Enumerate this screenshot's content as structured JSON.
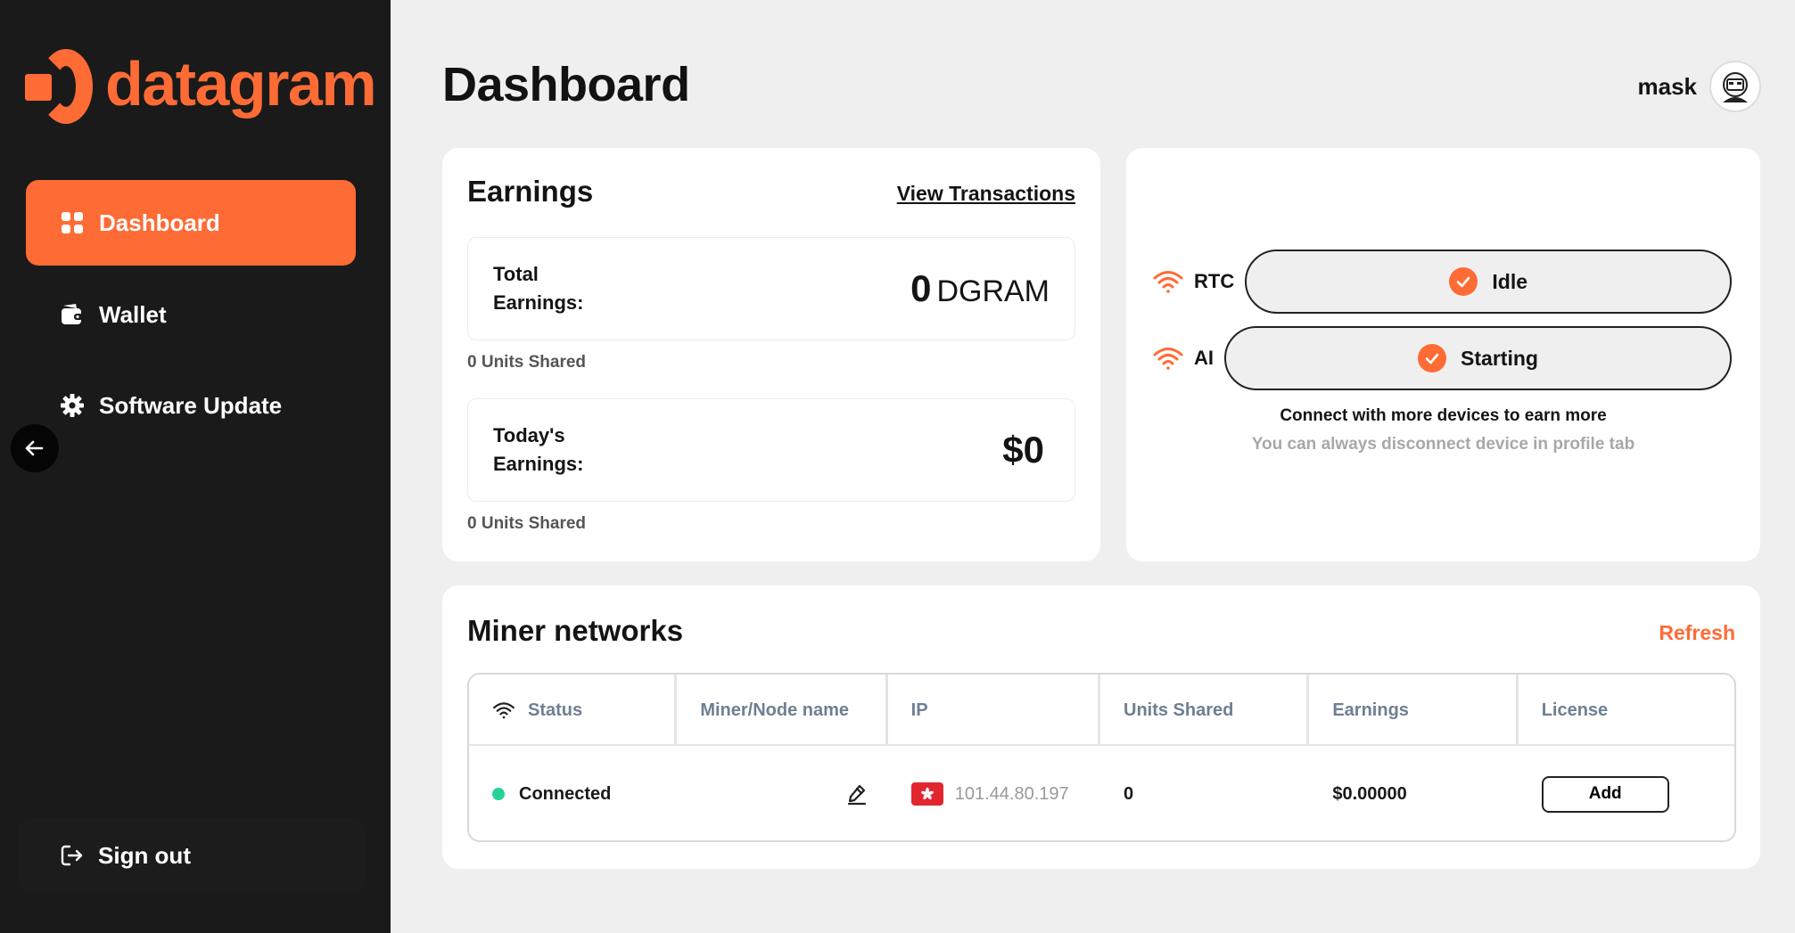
{
  "brand": {
    "name": "datagram",
    "color": "#ff6b35"
  },
  "sidebar": {
    "items": [
      {
        "label": "Dashboard",
        "icon": "grid-icon",
        "active": true
      },
      {
        "label": "Wallet",
        "icon": "wallet-icon",
        "active": false
      },
      {
        "label": "Software Update",
        "icon": "gear-icon",
        "active": false
      }
    ],
    "collapse_icon": "arrow-left-icon",
    "signout_label": "Sign out"
  },
  "header": {
    "title": "Dashboard",
    "user_name": "mask"
  },
  "earnings": {
    "title": "Earnings",
    "view_transactions": "View Transactions",
    "total": {
      "label": "Total Earnings:",
      "value": "0",
      "unit": "DGRAM",
      "units_shared": "0 Units Shared"
    },
    "today": {
      "label": "Today's Earnings:",
      "value": "$0",
      "units_shared": "0 Units Shared"
    }
  },
  "devices": {
    "rows": [
      {
        "label": "RTC",
        "status": "Idle"
      },
      {
        "label": "AI",
        "status": "Starting"
      }
    ],
    "note": "Connect with more devices to earn more",
    "subnote": "You can always disconnect device in profile tab"
  },
  "miner": {
    "title": "Miner networks",
    "refresh": "Refresh",
    "columns": [
      "Status",
      "Miner/Node name",
      "IP",
      "Units Shared",
      "Earnings",
      "License"
    ],
    "rows": [
      {
        "status": "Connected",
        "name": "",
        "ip": "101.44.80.197",
        "units": "0",
        "earnings": "$0.00000",
        "license_action": "Add"
      }
    ]
  },
  "colors": {
    "accent": "#ff6b35",
    "connected": "#25d39a",
    "sidebar_bg": "#1a1a1a"
  }
}
